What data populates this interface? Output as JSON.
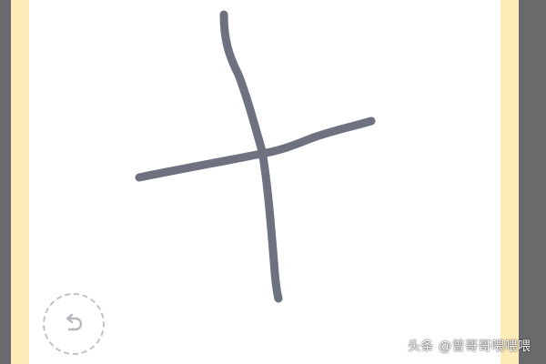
{
  "colors": {
    "side_panel": "#6a6a6c",
    "frame": "#fdecb8",
    "canvas": "#ffffff",
    "stroke": "#6d7180",
    "undo_border": "#c2c2c6"
  },
  "toolbar": {
    "undo_icon": "undo-icon"
  },
  "watermark": {
    "text": "头条 @曾哥哥喂喂喂"
  }
}
